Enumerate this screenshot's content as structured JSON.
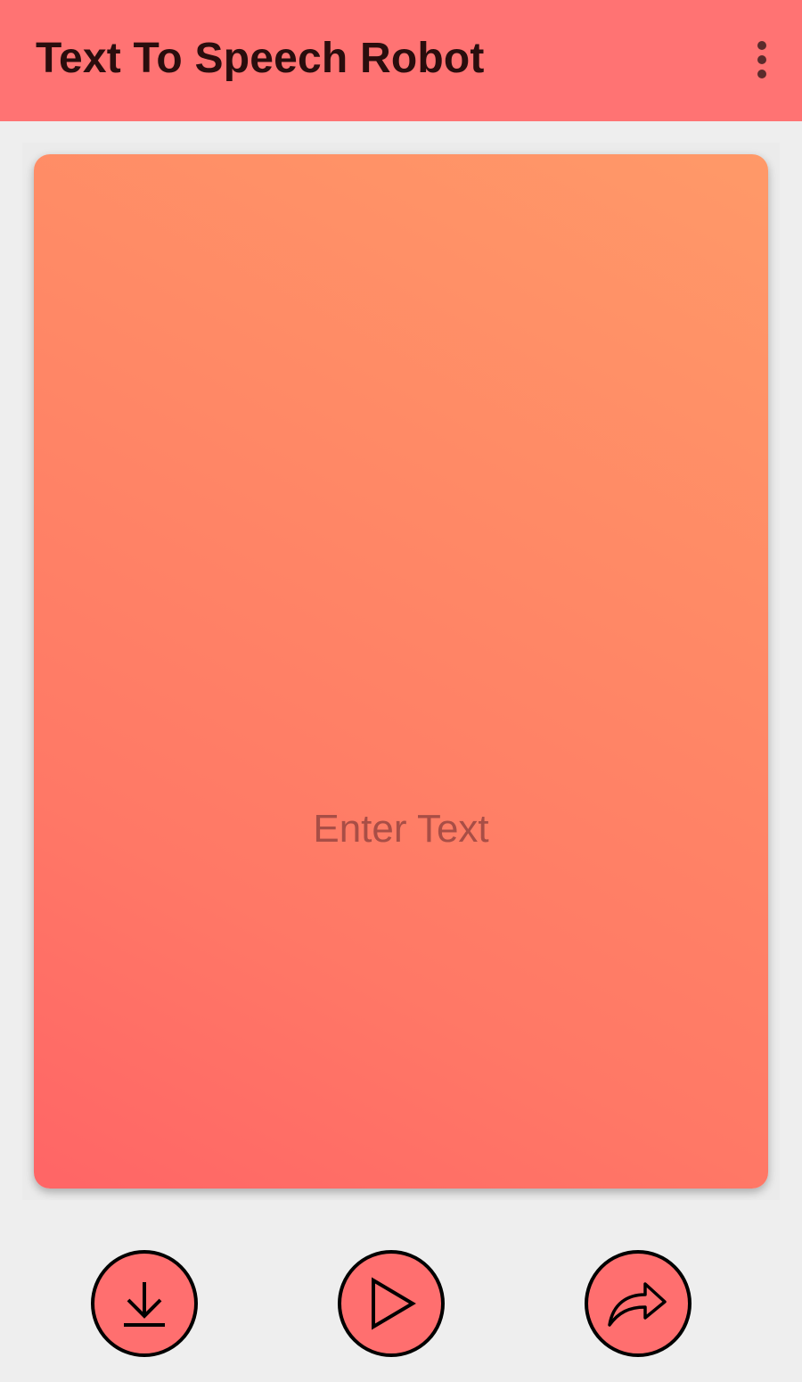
{
  "app_bar": {
    "title": "Text To Speech Robot",
    "menu_icon": "more-vert-icon",
    "background": "#ff7373"
  },
  "editor": {
    "placeholder": "Enter Text",
    "value": "",
    "gradient_colors": [
      "#ff9968",
      "#ff6566"
    ]
  },
  "actions": [
    {
      "name": "download",
      "icon": "download-icon"
    },
    {
      "name": "play",
      "icon": "play-icon"
    },
    {
      "name": "share",
      "icon": "share-icon"
    }
  ],
  "colors": {
    "accent": "#ff6f6f",
    "background": "#eeeeee"
  }
}
